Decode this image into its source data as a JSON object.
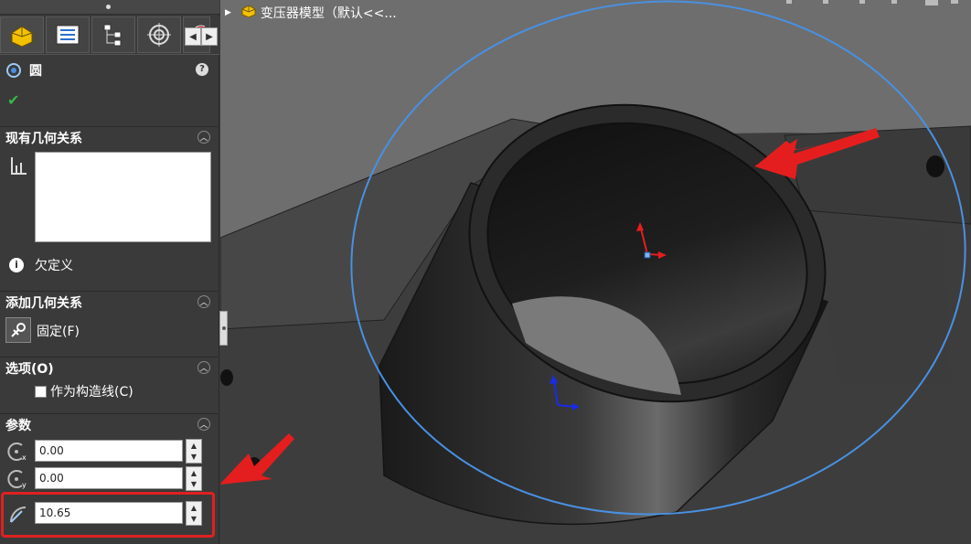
{
  "feature_tree": {
    "part_name": "变压器模型（默认<<..."
  },
  "property_manager": {
    "title": "圆",
    "sections": {
      "existing_relations": "现有几何关系",
      "add_relations": "添加几何关系",
      "options": "选项(O)",
      "parameters": "参数"
    },
    "status": "欠定义",
    "fix_relation_label": "固定(F)",
    "construction_label": "作为构造线(C)",
    "params": {
      "center_x": "0.00",
      "center_y": "0.00",
      "radius": "10.65"
    }
  },
  "colors": {
    "sketch_circle": "#4a90e2",
    "annotation_arrow": "#e41e1e",
    "highlight_box": "#e02020"
  }
}
